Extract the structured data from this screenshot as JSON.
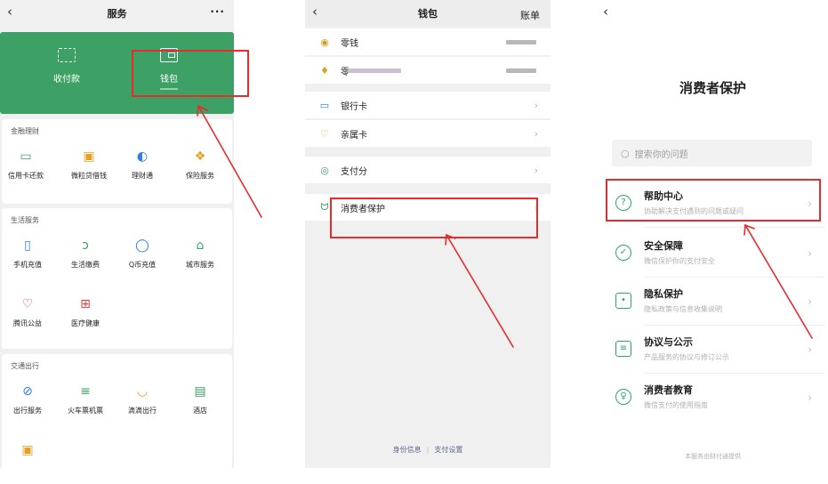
{
  "panel1": {
    "title": "服务",
    "back_icon": "chevron-left-icon",
    "more": "···",
    "green_items": [
      {
        "label": "收付款",
        "icon": "scan-icon"
      },
      {
        "label": "钱包",
        "icon": "wallet-icon"
      }
    ],
    "sections": [
      {
        "title": "金融理财",
        "items": [
          {
            "label": "信用卡还款",
            "icon": "credit-card-icon",
            "glyph": "▭",
            "color": "#3da165"
          },
          {
            "label": "微粒贷借钱",
            "icon": "loan-icon",
            "glyph": "▣",
            "color": "#e8a020"
          },
          {
            "label": "理财通",
            "icon": "wealth-icon",
            "glyph": "◐",
            "color": "#2d7ce0"
          },
          {
            "label": "保险服务",
            "icon": "insurance-icon",
            "glyph": "❖",
            "color": "#e8a020"
          }
        ]
      },
      {
        "title": "生活服务",
        "items": [
          {
            "label": "手机充值",
            "icon": "phone-icon",
            "glyph": "▯",
            "color": "#2d7ce0"
          },
          {
            "label": "生活缴费",
            "icon": "leaf-icon",
            "glyph": "ↄ",
            "color": "#3da165"
          },
          {
            "label": "Q币充值",
            "icon": "q-icon",
            "glyph": "◯",
            "color": "#2d7ce0"
          },
          {
            "label": "城市服务",
            "icon": "city-icon",
            "glyph": "⌂",
            "color": "#3da165"
          },
          {
            "label": "腾讯公益",
            "icon": "heart-icon",
            "glyph": "♡",
            "color": "#e04040"
          },
          {
            "label": "医疗健康",
            "icon": "medical-icon",
            "glyph": "⊞",
            "color": "#e04040"
          }
        ]
      },
      {
        "title": "交通出行",
        "items": [
          {
            "label": "出行服务",
            "icon": "compass-icon",
            "glyph": "⊘",
            "color": "#2d7ce0"
          },
          {
            "label": "火车票机票",
            "icon": "train-icon",
            "glyph": "≡",
            "color": "#3da165"
          },
          {
            "label": "滴滴出行",
            "icon": "didi-icon",
            "glyph": "◡",
            "color": "#e8a020"
          },
          {
            "label": "酒店",
            "icon": "hotel-icon",
            "glyph": "▤",
            "color": "#3da165"
          }
        ]
      }
    ]
  },
  "panel2": {
    "title": "钱包",
    "back_icon": "chevron-left-icon",
    "right": "账单",
    "rows": [
      {
        "label": "零钱",
        "icon": "coin-icon",
        "glyph": "◉",
        "color": "#d8a020"
      },
      {
        "label": "零",
        "icon": "diamond-icon",
        "glyph": "♦",
        "color": "#d8a020"
      },
      {
        "label": "银行卡",
        "icon": "bank-card-icon",
        "glyph": "▭",
        "color": "#2d7ce0"
      },
      {
        "label": "亲属卡",
        "icon": "family-card-icon",
        "glyph": "♡",
        "color": "#e8a020"
      },
      {
        "label": "支付分",
        "icon": "score-icon",
        "glyph": "◎",
        "color": "#3da165"
      },
      {
        "label": "消费者保护",
        "icon": "consumer-protection-icon",
        "glyph": "ᗢ",
        "color": "#3da165"
      }
    ],
    "footer_left": "身份信息",
    "footer_sep": "|",
    "footer_right": "支付设置"
  },
  "panel3": {
    "back_icon": "chevron-left-icon",
    "title": "消费者保护",
    "search_placeholder": "搜索你的问题",
    "rows": [
      {
        "title": "帮助中心",
        "subtitle": "协助解决支付遇到的问题或疑问",
        "icon": "help-icon",
        "glyph": "?"
      },
      {
        "title": "安全保障",
        "subtitle": "微信保护你的支付安全",
        "icon": "shield-icon",
        "glyph": "✓"
      },
      {
        "title": "隐私保护",
        "subtitle": "隐私政策与信息收集说明",
        "icon": "lock-icon",
        "glyph": "•"
      },
      {
        "title": "协议与公示",
        "subtitle": "产品服务的协议与修订公示",
        "icon": "document-icon",
        "glyph": "≡"
      },
      {
        "title": "消费者教育",
        "subtitle": "微信支付的使用指南",
        "icon": "bulb-icon",
        "glyph": "♀"
      }
    ],
    "provider": "本服务由财付通提供"
  },
  "highlight_color": "#e52d2d"
}
